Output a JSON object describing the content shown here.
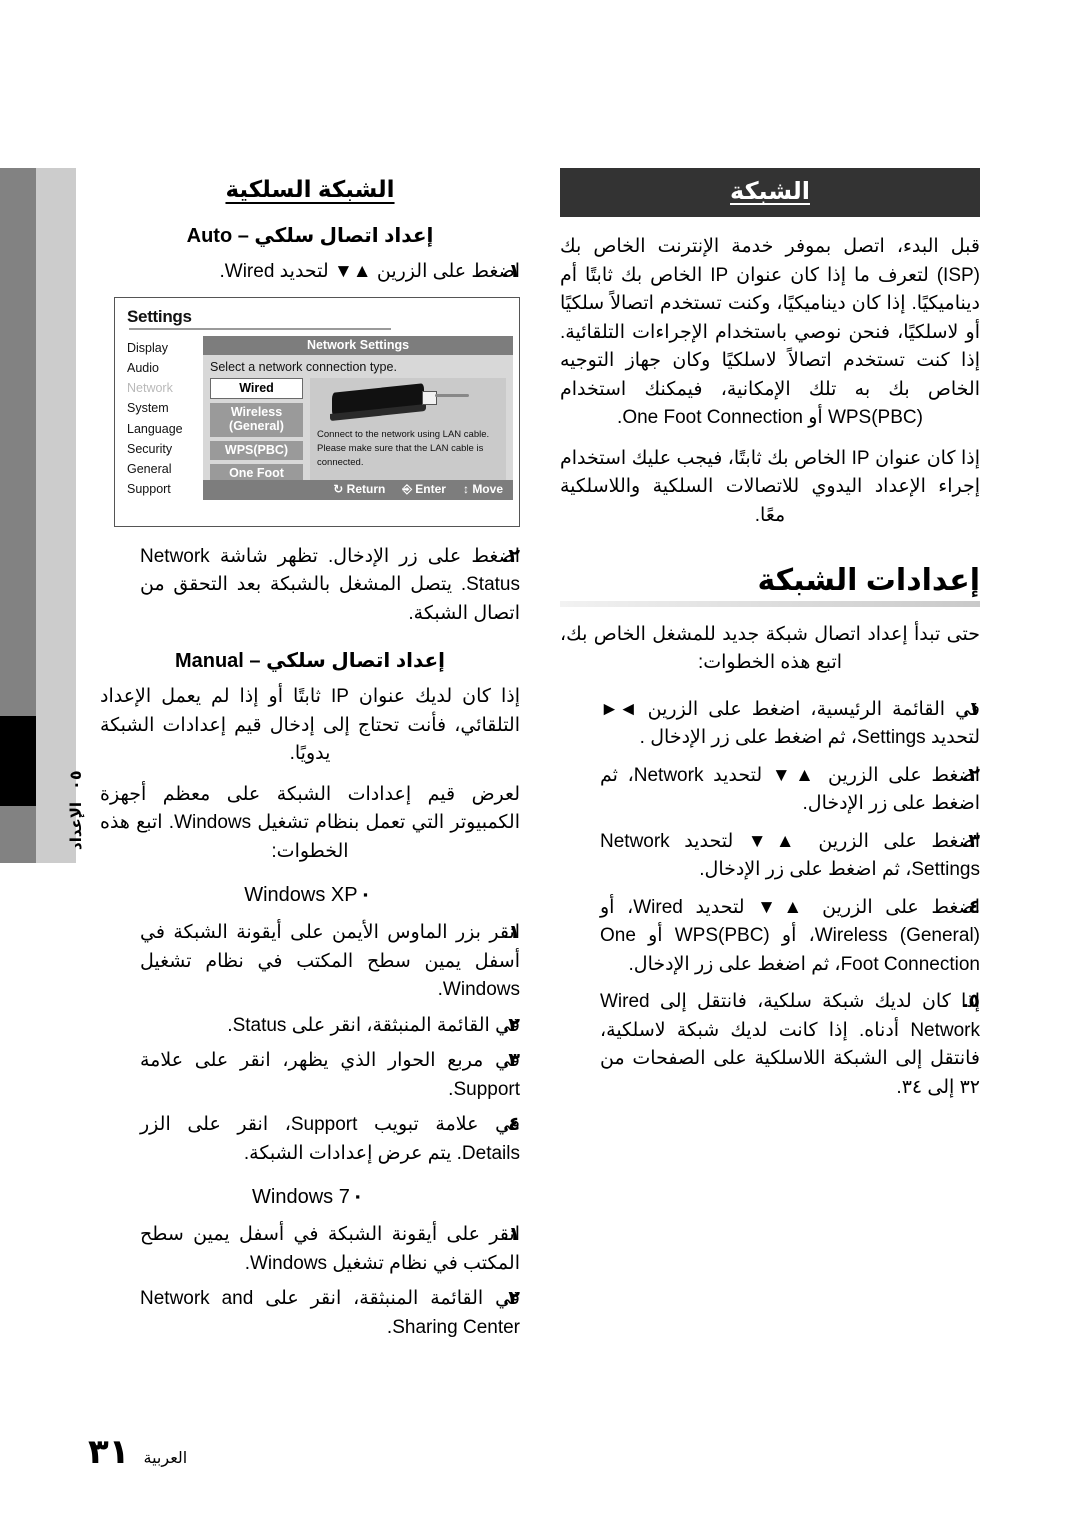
{
  "edge_tab": {
    "chapter_number": "٠٥",
    "chapter_label": "الإعداد"
  },
  "footer": {
    "page_number": "٣١",
    "language_label": "العربية"
  },
  "right_column": {
    "banner_title": "الشبكة",
    "intro_paragraph_1": "قبل البدء، اتصل بموفر خدمة الإنترنت الخاص بك (ISP) لتعرف ما إذا كان عنوان IP الخاص بك ثابتًا أم ديناميكيًا. إذا كان ديناميكيًا، وكنت تستخدم اتصالاً سلكيًا أو لاسلكيًا، فنحن نوصي باستخدام الإجراءات التلقائية. إذا كنت تستخدم اتصالاً لاسلكيًا وكان جهاز التوجيه الخاص بك به تلك الإمكانية، فيمكنك استخدام WPS(PBC) أو One Foot Connection.",
    "intro_paragraph_2": "إذا كان عنوان IP الخاص بك ثابتًا، فيجب عليك استخدام إجراء الإعداد اليدوي للاتصالات السلكية واللاسلكية معًا.",
    "section_title": "إعدادات الشبكة",
    "section_intro": "حتى تبدأ إعداد اتصال شبكة جديد للمشغل الخاص بك، اتبع هذه الخطوات:",
    "steps": [
      {
        "marker": "١.",
        "text": "في القائمة الرئيسية، اضغط على الزرين ◄► لتحديد Settings، ثم اضغط على زر الإدخال ."
      },
      {
        "marker": "٢.",
        "text": "اضغط على الزرين ▲▼ لتحديد Network، ثم اضغط على زر الإدخال."
      },
      {
        "marker": "٣.",
        "text": "اضغط على الزرين ▲▼ لتحديد Network Settings، ثم اضغط على زر الإدخال."
      },
      {
        "marker": "٤.",
        "text": "اضغط على الزرين ▲▼ لتحديد Wired، أو Wireless (General)، أو WPS(PBC) أو One Foot Connection، ثم اضغط على زر الإدخال."
      },
      {
        "marker": "٥.",
        "text": "إذا كان لديك شبكة سلكية، فانتقل إلى Wired Network أدناه. إذا كانت لديك شبكة لاسلكية، فانتقل إلى الشبكة اللاسلكية على الصفحات من ٣٢ إلى ٣٤."
      }
    ]
  },
  "left_column": {
    "section_title": "الشبكة السلكية",
    "auto_heading": "إعداد اتصال سلكي – Auto",
    "auto_steps": [
      {
        "marker": "١.",
        "text": "اضغط على الزرين ▲▼ لتحديد Wired."
      },
      {
        "marker": "٢.",
        "text": "اضغط على زر الإدخال. تظهر شاشة Network Status. يتصل المشغل بالشبكة بعد التحقق من اتصال الشبكة."
      }
    ],
    "manual_heading": "إعداد اتصال سلكي – Manual",
    "manual_paragraph_1": "إذا كان لديك عنوان IP ثابتًا أو إذا لم يعمل الإعداد التلقائي، فأنت تحتاج إلى إدخال قيم إعدادات الشبكة يدويًا.",
    "manual_paragraph_2": "لعرض قيم إعدادات الشبكة على معظم أجهزة الكمبيوتر التي تعمل بنظام تشغيل Windows. اتبع هذه الخطوات:",
    "winxp_bullet": "Windows XP",
    "winxp_steps": [
      {
        "marker": "١.",
        "text": "انقر بزر الماوس الأيمن على أيقونة الشبكة في أسفل يمين سطح المكتب في نظام تشغيل Windows."
      },
      {
        "marker": "٢.",
        "text": "في القائمة المنبثقة، انقر على Status."
      },
      {
        "marker": "٣.",
        "text": "في مربع الحوار الذي يظهر، انقر على علامة Support."
      },
      {
        "marker": "٤.",
        "text": "في علامة تبويب Support، انقر على الزر Details. يتم عرض إعدادات الشبكة."
      }
    ],
    "win7_bullet": "Windows 7",
    "win7_steps": [
      {
        "marker": "١.",
        "text": "انقر على أيقونة الشبكة في أسفل يمين سطح المكتب في نظام تشغيل Windows."
      },
      {
        "marker": "٢.",
        "text": "في القائمة المنبثقة، انقر على Network and Sharing Center."
      }
    ]
  },
  "figure": {
    "window_title": "Settings",
    "menu_items": [
      {
        "label": "Display",
        "state": "normal"
      },
      {
        "label": "Audio",
        "state": "normal"
      },
      {
        "label": "Network",
        "state": "dimmed"
      },
      {
        "label": "System",
        "state": "normal"
      },
      {
        "label": "Language",
        "state": "normal"
      },
      {
        "label": "Security",
        "state": "normal"
      },
      {
        "label": "General",
        "state": "normal"
      },
      {
        "label": "Support",
        "state": "normal"
      }
    ],
    "panel_title": "Network Settings",
    "panel_subtitle": "Select a network connection type.",
    "options": [
      {
        "label": "Wired",
        "selected": true
      },
      {
        "label": "Wireless (General)",
        "selected": false
      },
      {
        "label": "WPS(PBC)",
        "selected": false
      },
      {
        "label": "One Foot Connection",
        "selected": false
      }
    ],
    "description": "Connect to the network using LAN cable. Please make sure that the LAN cable is connected.",
    "footer_hints": [
      {
        "icon": "up-down-arrow-icon",
        "label": "Move"
      },
      {
        "icon": "enter-key-icon",
        "label": "Enter"
      },
      {
        "icon": "return-arrow-icon",
        "label": "Return"
      }
    ]
  },
  "colors": {
    "banner_bg": "#333333",
    "edge_tab_gray": "#828282",
    "edge_tab_black": "#000000",
    "edge_label_bg": "#cccccc"
  }
}
